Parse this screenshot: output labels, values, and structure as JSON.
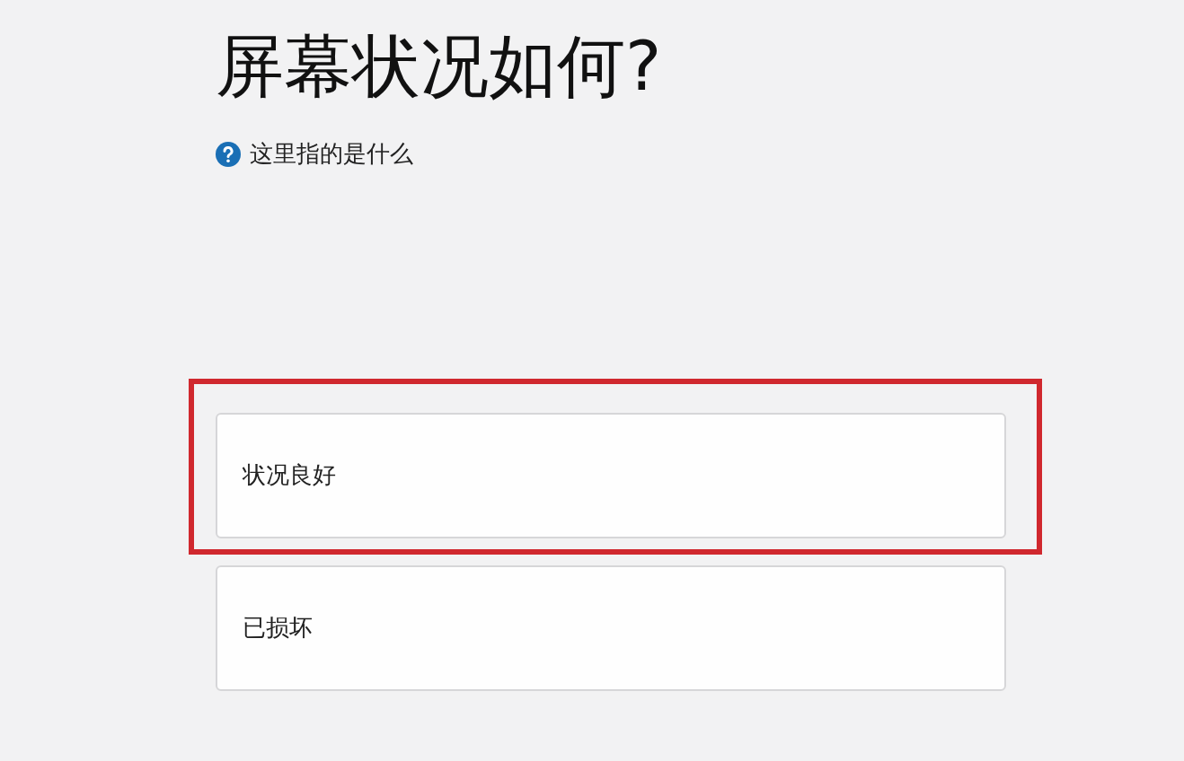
{
  "title": "屏幕状况如何?",
  "help_link": "这里指的是什么",
  "options": [
    {
      "label": "状况良好",
      "highlighted": true
    },
    {
      "label": "已损坏",
      "highlighted": false
    }
  ]
}
